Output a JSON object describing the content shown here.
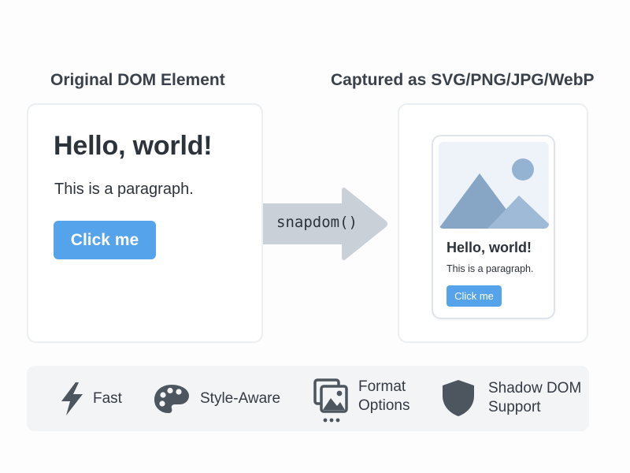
{
  "left_panel": {
    "title": "Original DOM Element",
    "heading": "Hello, world!",
    "paragraph": "This is a paragraph.",
    "button_label": "Click me"
  },
  "arrow": {
    "label": "snapdom()",
    "color": "#c9d0d8"
  },
  "right_panel": {
    "title": "Captured as SVG/PNG/JPG/WebP",
    "preview": {
      "image_icon": "mountain-sun-icon",
      "heading": "Hello, world!",
      "paragraph": "This is a paragraph.",
      "button_label": "Click me"
    }
  },
  "features": [
    {
      "icon": "lightning-icon",
      "line1": "Fast",
      "line2": ""
    },
    {
      "icon": "palette-icon",
      "line1": "Style-Aware",
      "line2": ""
    },
    {
      "icon": "images-icon",
      "line1": "Format",
      "line2": "Options"
    },
    {
      "icon": "shield-icon",
      "line1": "Shadow DOM",
      "line2": "Support"
    }
  ],
  "colors": {
    "accent": "#55a3ea",
    "icon": "#4d565f",
    "mountain_back": "#87a5c4",
    "mountain_front": "#9fbad6",
    "sun": "#94b3d3"
  }
}
